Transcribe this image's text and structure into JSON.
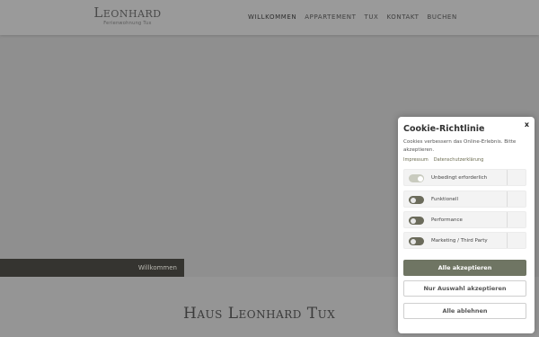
{
  "header": {
    "logo_title": "Leonhard",
    "logo_sub": "Ferienwohnung Tux",
    "nav": [
      "WILLKOMMEN",
      "APPARTEMENT",
      "TUX",
      "KONTAKT",
      "BUCHEN"
    ]
  },
  "hero": {
    "tab_label": "Willkommen",
    "main_title": "Haus Leonhard Tux"
  },
  "cookie": {
    "close": "x",
    "title": "Cookie-Richtlinie",
    "text": "Cookies verbessern das Online-Erlebnis. Bitte akzeptieren.",
    "links": [
      "Impressum",
      "Datenschutzerklärung"
    ],
    "options": [
      "Unbedingt erforderlich",
      "Funktionell",
      "Performance",
      "Marketing / Third Party"
    ],
    "buttons": {
      "accept_all": "Alle akzeptieren",
      "accept_selection": "Nur Auswahl akzeptieren",
      "reject_all": "Alle ablehnen"
    }
  }
}
